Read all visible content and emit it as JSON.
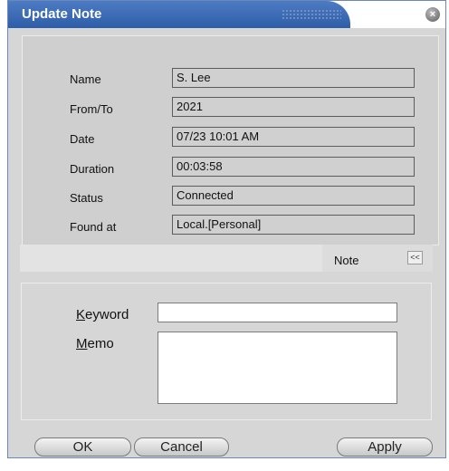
{
  "window": {
    "title": "Update Note",
    "close_icon": "close-icon"
  },
  "fields": [
    {
      "label": "Name",
      "value": "S. Lee"
    },
    {
      "label": "From/To",
      "value": "2021"
    },
    {
      "label": "Date",
      "value": "07/23 10:01 AM"
    },
    {
      "label": "Duration",
      "value": "00:03:58"
    },
    {
      "label": "Status",
      "value": "Connected"
    },
    {
      "label": "Found at",
      "value": "Local.[Personal]"
    }
  ],
  "note_section": {
    "label": "Note",
    "collapse_label": "<<"
  },
  "note_form": {
    "keyword_label_accel": "K",
    "keyword_label_rest": "eyword",
    "keyword_value": "",
    "memo_label_accel": "M",
    "memo_label_rest": "emo",
    "memo_value": ""
  },
  "buttons": {
    "ok": "OK",
    "cancel": "Cancel",
    "apply": "Apply"
  }
}
